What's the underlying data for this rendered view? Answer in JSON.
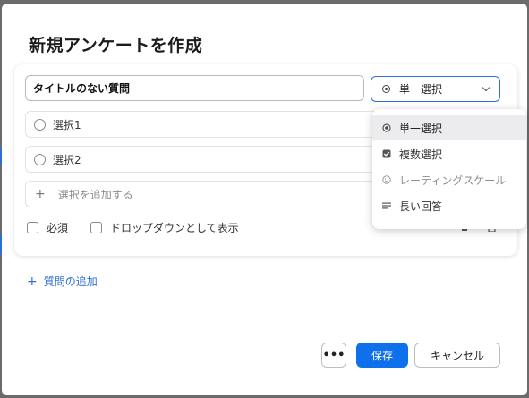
{
  "dialog": {
    "title": "新規アンケートを作成"
  },
  "question": {
    "title_value": "タイトルのない質問",
    "type_selected": "単一選択",
    "choices": [
      {
        "label": "選択1"
      },
      {
        "label": "選択2"
      }
    ],
    "add_choice_label": "選択を追加する",
    "required_label": "必須",
    "dropdown_label": "ドロップダウンとして表示"
  },
  "type_menu": {
    "items": [
      {
        "label": "単一選択",
        "icon": "radio-icon",
        "state": "selected"
      },
      {
        "label": "複数選択",
        "icon": "checkbox-icon",
        "state": "enabled"
      },
      {
        "label": "レーティングスケール",
        "icon": "smiley-icon",
        "state": "disabled"
      },
      {
        "label": "長い回答",
        "icon": "lines-icon",
        "state": "enabled"
      }
    ]
  },
  "add_question_label": "質問の追加",
  "footer": {
    "more_label": "•••",
    "save_label": "保存",
    "cancel_label": "キャンセル"
  },
  "colors": {
    "accent": "#0e71eb",
    "link": "#2d6fd6",
    "menu_highlight": "#ececef"
  }
}
